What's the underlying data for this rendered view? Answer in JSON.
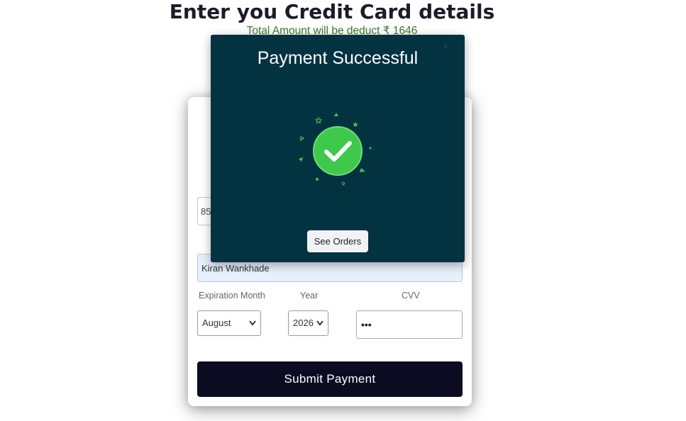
{
  "header": {
    "title": "Enter you Credit Card details",
    "amount_text": "Total Amount will be deduct ₹ 1646"
  },
  "form": {
    "card_number_partial": "85",
    "cardholder_name": "Kiran Wankhade",
    "labels": {
      "expiration_month": "Expiration Month",
      "year": "Year",
      "cvv": "CVV"
    },
    "month_selected": "August",
    "year_selected": "2026",
    "cvv_value": "•••",
    "submit_label": "Submit Payment"
  },
  "modal": {
    "title": "Payment Successful",
    "close_label": "×",
    "button_label": "See Orders",
    "icon": "checkmark-circle-icon"
  },
  "colors": {
    "modal_bg": "#033241",
    "success_green": "#3ec94a",
    "submit_bg": "#0b0c22",
    "amount_text": "#3a7a2c"
  }
}
